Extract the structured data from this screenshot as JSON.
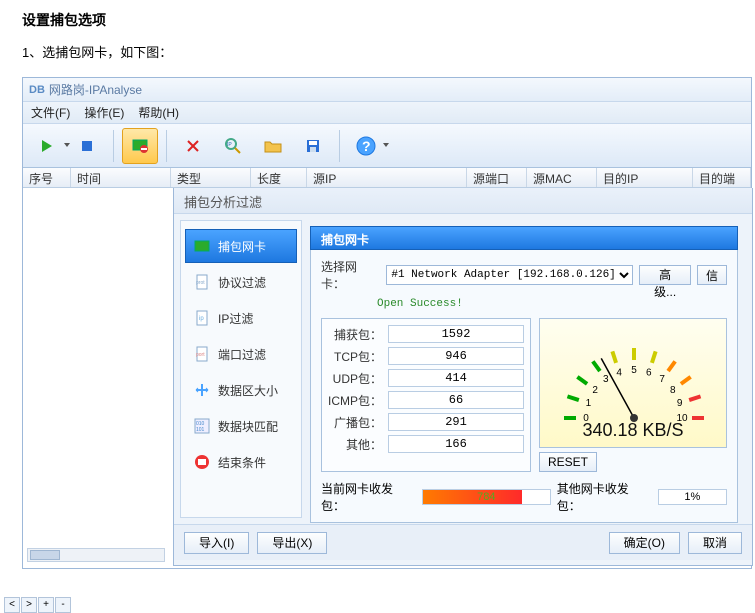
{
  "doc": {
    "title": "设置捕包选项",
    "step": "1、选捕包网卡，如下图："
  },
  "window": {
    "logo": "DB",
    "title": "网路岗-IPAnalyse"
  },
  "menu": {
    "file": "文件(F)",
    "op": "操作(E)",
    "help": "帮助(H)"
  },
  "columns": {
    "seq": "序号",
    "time": "时间",
    "type": "类型",
    "len": "长度",
    "srcip": "源IP",
    "srcport": "源端口",
    "srcmac": "源MAC",
    "dstip": "目的IP",
    "dstport": "目的端"
  },
  "dialog": {
    "title": "捕包分析过滤",
    "nav": {
      "nic": "捕包网卡",
      "proto": "协议过滤",
      "ip": "IP过滤",
      "port": "端口过滤",
      "size": "数据区大小",
      "block": "数据块匹配",
      "end": "结束条件"
    },
    "panel_title": "捕包网卡",
    "select_label": "选择网卡：",
    "adapter": "#1 Network Adapter [192.168.0.126]",
    "adv": "高级...",
    "info": "信",
    "open_status": "Open Success!",
    "stats": {
      "cap": {
        "label": "捕获包：",
        "val": "1592"
      },
      "tcp": {
        "label": "TCP包：",
        "val": "946"
      },
      "udp": {
        "label": "UDP包：",
        "val": "414"
      },
      "icmp": {
        "label": "ICMP包：",
        "val": "66"
      },
      "bcast": {
        "label": "广播包：",
        "val": "291"
      },
      "other": {
        "label": "其他：",
        "val": "166"
      }
    },
    "gauge_text": "340.18 KB/S",
    "reset": "RESET",
    "traffic": {
      "cur_label": "当前网卡收发包：",
      "cur_val": "784",
      "other_label": "其他网卡收发包：",
      "other_val": "1%"
    },
    "buttons": {
      "import": "导入(I)",
      "export": "导出(X)",
      "ok": "确定(O)",
      "cancel": "取消"
    }
  }
}
